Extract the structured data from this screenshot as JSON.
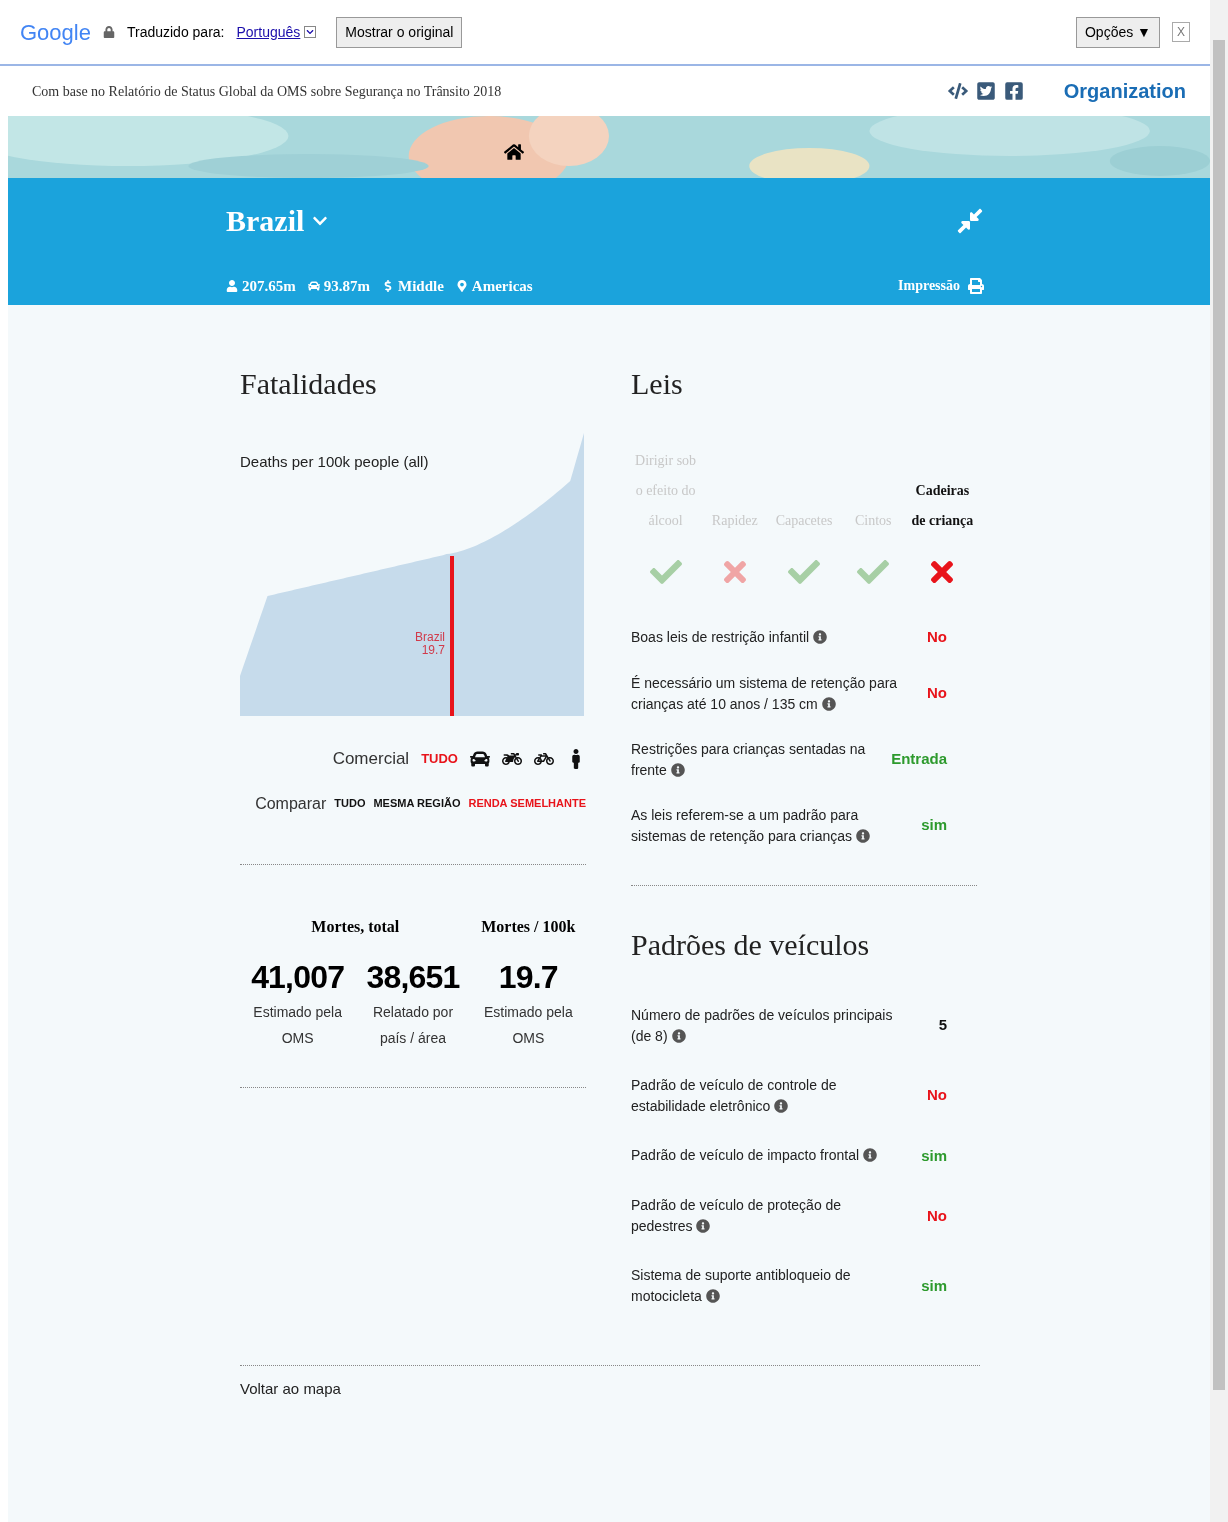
{
  "translate_bar": {
    "logo": "Google",
    "label": "Traduzido para:",
    "language": "Português",
    "show_original": "Mostrar o original",
    "options": "Opções ▼",
    "close": "X"
  },
  "site_header": {
    "subtitle": "Com base no Relatório de Status Global da OMS sobre Segurança no Trânsito 2018",
    "organization": "Organization"
  },
  "country": {
    "name": "Brazil",
    "stats": [
      {
        "kind": "population",
        "text": "207.65m"
      },
      {
        "kind": "vehicles",
        "text": "93.87m"
      },
      {
        "kind": "income",
        "text": "Middle"
      },
      {
        "kind": "region",
        "text": "Americas"
      }
    ],
    "print": "Impressão"
  },
  "fatalities": {
    "title": "Fatalidades",
    "chart_label": "Deaths per 100k people (all)",
    "marker_label": "Brazil",
    "marker_value": "19.7",
    "mode_label": "Comercial",
    "modes": [
      {
        "kind": "all",
        "label": "TUDO",
        "selected": true
      },
      {
        "kind": "car",
        "selected": false
      },
      {
        "kind": "motorcycle",
        "selected": false
      },
      {
        "kind": "bicycle",
        "selected": false
      },
      {
        "kind": "pedestrian",
        "selected": false
      }
    ],
    "compare_label": "Comparar",
    "compare": [
      {
        "label": "TUDO",
        "selected": false
      },
      {
        "label": "MESMA REGIÃO",
        "selected": false
      },
      {
        "label": "RENDA SEMELHANTE",
        "selected": true
      }
    ],
    "headers": [
      "Mortes, total",
      "Mortes / 100k"
    ],
    "stats": [
      {
        "value": "41,007",
        "caption": "Estimado pela OMS"
      },
      {
        "value": "38,651",
        "caption": "Relatado por país / área"
      },
      {
        "value": "19.7",
        "caption": "Estimado pela OMS"
      }
    ]
  },
  "laws": {
    "title": "Leis",
    "categories": [
      {
        "label": "Dirigir sob o efeito do álcool",
        "passed": true,
        "selected": false
      },
      {
        "label": "Rapidez",
        "passed": false,
        "selected": false
      },
      {
        "label": "Capacetes",
        "passed": true,
        "selected": false
      },
      {
        "label": "Cintos",
        "passed": true,
        "selected": false
      },
      {
        "label": "Cadeiras de criança",
        "passed": false,
        "selected": true
      }
    ],
    "rows": [
      {
        "label": "Boas leis de restrição infantil",
        "value": "No",
        "color": "#e8141b"
      },
      {
        "label": "É necessário um sistema de retenção para crianças até 10 anos / 135 cm",
        "value": "No",
        "color": "#e8141b"
      },
      {
        "label": "Restrições para crianças sentadas na frente",
        "value": "Entrada",
        "color": "#2d9a2d"
      },
      {
        "label": "As leis referem-se a um padrão para sistemas de retenção para crianças",
        "value": "sim",
        "color": "#2d9a2d"
      }
    ]
  },
  "vehicle_standards": {
    "title": "Padrões de veículos",
    "rows": [
      {
        "label": "Número de padrões de veículos principais (de 8)",
        "value": "5",
        "color": "#111111"
      },
      {
        "label": "Padrão de veículo de controle de estabilidade eletrônico",
        "value": "No",
        "color": "#e8141b"
      },
      {
        "label": "Padrão de veículo de impacto frontal",
        "value": "sim",
        "color": "#2d9a2d"
      },
      {
        "label": "Padrão de veículo de proteção de pedestres",
        "value": "No",
        "color": "#e8141b"
      },
      {
        "label": "Sistema de suporte antibloqueio de motocicleta",
        "value": "sim",
        "color": "#2d9a2d"
      }
    ]
  },
  "back_link": "Voltar ao mapa"
}
